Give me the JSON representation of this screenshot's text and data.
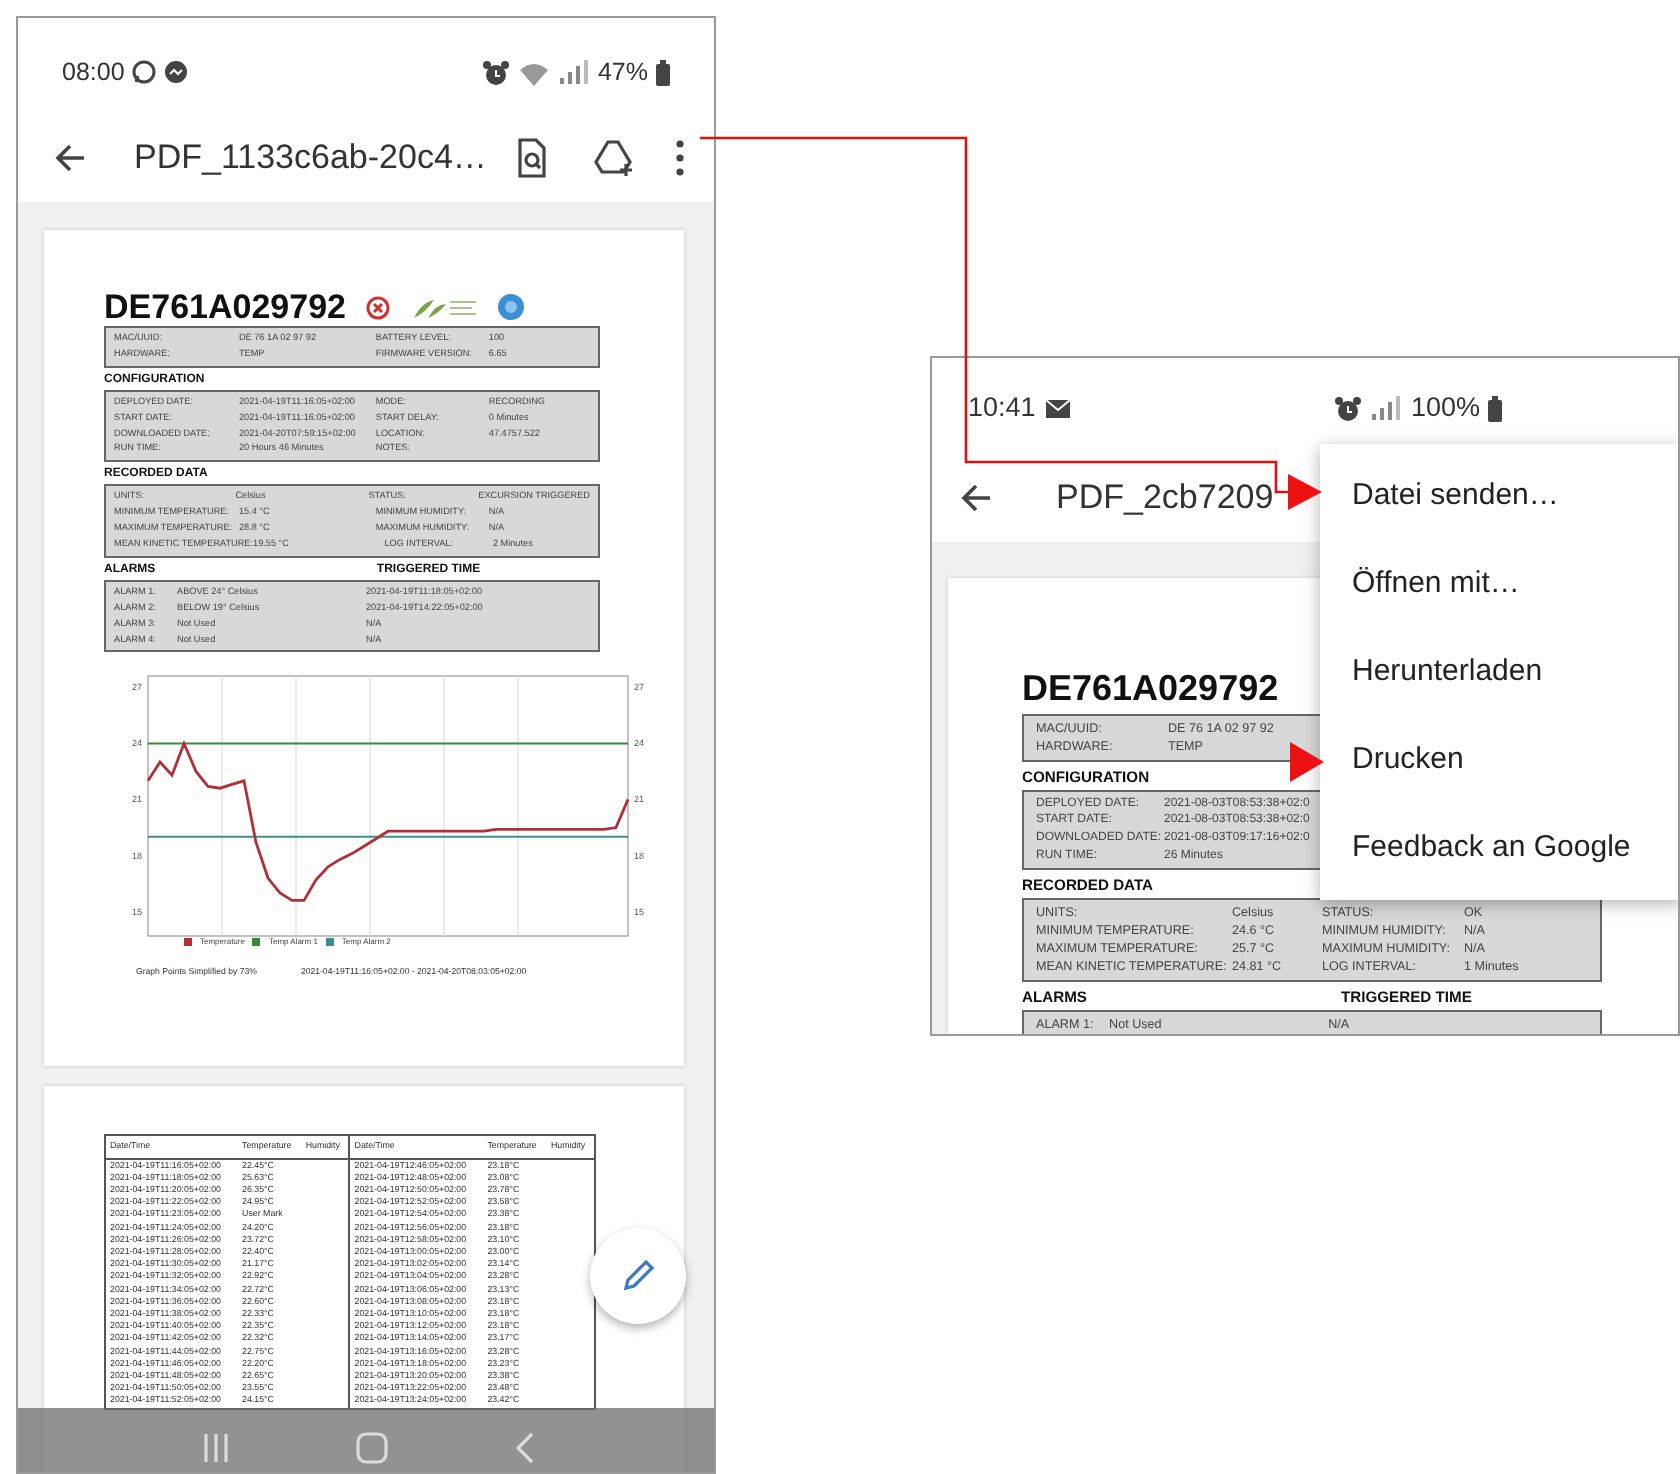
{
  "left_screen": {
    "status_bar": {
      "time": "08:00",
      "battery": "47%"
    },
    "app_bar": {
      "title": "PDF_1133c6ab-20c4…"
    },
    "report": {
      "device_id": "DE761A029792",
      "info_rows": [
        [
          "MAC/UUID:",
          "DE 76 1A 02 97 92",
          "BATTERY LEVEL:",
          "100"
        ],
        [
          "HARDWARE:",
          "TEMP",
          "FIRMWARE VERSION:",
          "6.65"
        ]
      ],
      "sections": [
        {
          "heading": "CONFIGURATION",
          "rows": [
            [
              "DEPLOYED DATE:",
              "2021-04-19T11:16:05+02:00",
              "MODE:",
              "RECORDING"
            ],
            [
              "START DATE:",
              "2021-04-19T11:16:05+02:00",
              "START DELAY:",
              "0 Minutes"
            ],
            [
              "DOWNLOADED DATE:",
              "2021-04-20T07:59:15+02:00",
              "LOCATION:",
              "47.4757.522"
            ],
            [
              "RUN TIME:",
              "20 Hours 46 Minutes",
              "NOTES:"
            ]
          ]
        },
        {
          "heading": "RECORDED DATA",
          "rows": [
            [
              "UNITS:",
              "Celsius",
              "STATUS:",
              "EXCURSION TRIGGERED"
            ],
            [
              "MINIMUM TEMPERATURE:",
              "15.4 °C",
              "MINIMUM HUMIDITY:",
              "N/A"
            ],
            [
              "MAXIMUM TEMPERATURE:",
              "28.8 °C",
              "MAXIMUM HUMIDITY:",
              "N/A"
            ],
            [
              "MEAN KINETIC TEMPERATURE:",
              "19.55 °C",
              "LOG INTERVAL:",
              "2 Minutes"
            ]
          ]
        }
      ],
      "alarms": {
        "heading": "ALARMS",
        "time_heading": "TRIGGERED TIME",
        "rows": [
          [
            "ALARM 1:",
            "ABOVE 24° Celsius",
            "2021-04-19T11:18:05+02:00"
          ],
          [
            "ALARM 2:",
            "BELOW 19° Celsius",
            "2021-04-19T14:22:05+02:00"
          ],
          [
            "ALARM 3:",
            "Not Used",
            "N/A"
          ],
          [
            "ALARM 4:",
            "Not Used",
            "N/A"
          ]
        ]
      },
      "graph": {
        "chart_data": {
          "type": "line",
          "legend": "bottom",
          "ylim": [
            13.7,
            27.6
          ],
          "yticks": [
            15,
            18,
            21,
            24,
            27
          ],
          "y2lim": [
            13.7,
            27.6
          ],
          "y2ticks": [
            15,
            18,
            21,
            24,
            27
          ],
          "series": [
            {
              "name": "Temperature",
              "color": "#b0303a",
              "values": [
                22,
                23,
                22.3,
                24,
                22.5,
                21.7,
                21.6,
                21.8,
                22,
                18.7,
                16.8,
                16,
                15.6,
                15.6,
                16.7,
                17.4,
                17.8,
                18.1,
                18.5,
                18.9,
                19.3,
                19.3,
                19.3,
                19.3,
                19.3,
                19.3,
                19.3,
                19.3,
                19.3,
                19.4,
                19.4,
                19.4,
                19.4,
                19.4,
                19.4,
                19.4,
                19.4,
                19.4,
                19.4,
                19.5,
                21
              ]
            },
            {
              "name": "Temp Alarm 1",
              "color": "#3a8a3a",
              "values": [
                24,
                24,
                24,
                24,
                24,
                24,
                24,
                24,
                24,
                24,
                24,
                24,
                24,
                24,
                24,
                24,
                24,
                24,
                24,
                24,
                24,
                24,
                24,
                24,
                24,
                24,
                24,
                24,
                24,
                24,
                24,
                24,
                24,
                24,
                24,
                24,
                24,
                24,
                24,
                24,
                24
              ]
            },
            {
              "name": "Temp Alarm 2",
              "color": "#3a8f95",
              "values": [
                19,
                19,
                19,
                19,
                19,
                19,
                19,
                19,
                19,
                19,
                19,
                19,
                19,
                19,
                19,
                19,
                19,
                19,
                19,
                19,
                19,
                19,
                19,
                19,
                19,
                19,
                19,
                19,
                19,
                19,
                19,
                19,
                19,
                19,
                19,
                19,
                19,
                19,
                19,
                19,
                19
              ]
            }
          ]
        },
        "note": "Graph Points Simplified by 73%",
        "range": "2021-04-19T11:16:05+02:00 - 2021-04-20T08:03:05+02:00"
      }
    },
    "data_table": {
      "columns": [
        "Date/Time",
        "Temperature",
        "Humidity",
        "Date/Time",
        "Temperature",
        "Humidity"
      ],
      "rows": [
        [
          "2021-04-19T11:16:05+02:00",
          "22.45°C",
          "",
          "2021-04-19T12:46:05+02:00",
          "23.18°C",
          ""
        ],
        [
          "2021-04-19T11:18:05+02:00",
          "25.63°C",
          "",
          "2021-04-19T12:48:05+02:00",
          "23.08°C",
          ""
        ],
        [
          "2021-04-19T11:20:05+02:00",
          "26.35°C",
          "",
          "2021-04-19T12:50:05+02:00",
          "23.78°C",
          ""
        ],
        [
          "2021-04-19T11:22:05+02:00",
          "24.95°C",
          "",
          "2021-04-19T12:52:05+02:00",
          "23.58°C",
          ""
        ],
        [
          "2021-04-19T11:23:05+02:00",
          "User Mark",
          "",
          "2021-04-19T12:54:05+02:00",
          "23.38°C",
          ""
        ],
        [
          "2021-04-19T11:24:05+02:00",
          "24.20°C",
          "",
          "2021-04-19T12:56:05+02:00",
          "23.18°C",
          ""
        ],
        [
          "2021-04-19T11:26:05+02:00",
          "23.72°C",
          "",
          "2021-04-19T12:58:05+02:00",
          "23.10°C",
          ""
        ],
        [
          "2021-04-19T11:28:05+02:00",
          "22.40°C",
          "",
          "2021-04-19T13:00:05+02:00",
          "23.00°C",
          ""
        ],
        [
          "2021-04-19T11:30:05+02:00",
          "21.17°C",
          "",
          "2021-04-19T13:02:05+02:00",
          "23.14°C",
          ""
        ],
        [
          "2021-04-19T11:32:05+02:00",
          "22.92°C",
          "",
          "2021-04-19T13:04:05+02:00",
          "23.28°C",
          ""
        ],
        [
          "2021-04-19T11:34:05+02:00",
          "22.72°C",
          "",
          "2021-04-19T13:06:05+02:00",
          "23.13°C",
          ""
        ],
        [
          "2021-04-19T11:36:05+02:00",
          "22.60°C",
          "",
          "2021-04-19T13:08:05+02:00",
          "23.18°C",
          ""
        ],
        [
          "2021-04-19T11:38:05+02:00",
          "22.33°C",
          "",
          "2021-04-19T13:10:05+02:00",
          "23.18°C",
          ""
        ],
        [
          "2021-04-19T11:40:05+02:00",
          "22.35°C",
          "",
          "2021-04-19T13:12:05+02:00",
          "23.18°C",
          ""
        ],
        [
          "2021-04-19T11:42:05+02:00",
          "22.32°C",
          "",
          "2021-04-19T13:14:05+02:00",
          "23.17°C",
          ""
        ],
        [
          "2021-04-19T11:44:05+02:00",
          "22.75°C",
          "",
          "2021-04-19T13:16:05+02:00",
          "23.28°C",
          ""
        ],
        [
          "2021-04-19T11:46:05+02:00",
          "22.20°C",
          "",
          "2021-04-19T13:18:05+02:00",
          "23.23°C",
          ""
        ],
        [
          "2021-04-19T11:48:05+02:00",
          "22.65°C",
          "",
          "2021-04-19T13:20:05+02:00",
          "23.38°C",
          ""
        ],
        [
          "2021-04-19T11:50:05+02:00",
          "23.55°C",
          "",
          "2021-04-19T13:22:05+02:00",
          "23.48°C",
          ""
        ],
        [
          "2021-04-19T11:52:05+02:00",
          "24.15°C",
          "",
          "2021-04-19T13:24:05+02:00",
          "23.42°C",
          ""
        ]
      ]
    }
  },
  "right_screen": {
    "status_bar": {
      "time": "10:41",
      "battery": "100%"
    },
    "app_bar": {
      "title": "PDF_2cb7209"
    },
    "report": {
      "device_id": "DE761A029792",
      "info_rows": [
        [
          "MAC/UUID:",
          "DE 76 1A 02 97 92"
        ],
        [
          "HARDWARE:",
          "TEMP"
        ]
      ],
      "sections": [
        {
          "heading": "CONFIGURATION",
          "rows": [
            [
              "DEPLOYED DATE:",
              "2021-08-03T08:53:38+02:0"
            ],
            [
              "START DATE:",
              "2021-08-03T08:53:38+02:0"
            ],
            [
              "DOWNLOADED DATE:",
              "2021-08-03T09:17:16+02:0"
            ],
            [
              "RUN TIME:",
              "26 Minutes"
            ]
          ]
        },
        {
          "heading": "RECORDED DATA",
          "rows": [
            [
              "UNITS:",
              "Celsius",
              "STATUS:",
              "OK"
            ],
            [
              "MINIMUM TEMPERATURE:",
              "24.6 °C",
              "MINIMUM HUMIDITY:",
              "N/A"
            ],
            [
              "MAXIMUM TEMPERATURE:",
              "25.7 °C",
              "MAXIMUM HUMIDITY:",
              "N/A"
            ],
            [
              "MEAN KINETIC TEMPERATURE:",
              "24.81 °C",
              "LOG INTERVAL:",
              "1 Minutes"
            ]
          ]
        }
      ],
      "alarms": {
        "heading": "ALARMS",
        "time_heading": "TRIGGERED TIME",
        "rows": [
          [
            "ALARM 1:",
            "Not Used",
            "N/A"
          ]
        ]
      }
    },
    "menu": {
      "items": [
        "Datei senden…",
        "Öffnen mit…",
        "Herunterladen",
        "Drucken",
        "Feedback an Google"
      ]
    }
  }
}
